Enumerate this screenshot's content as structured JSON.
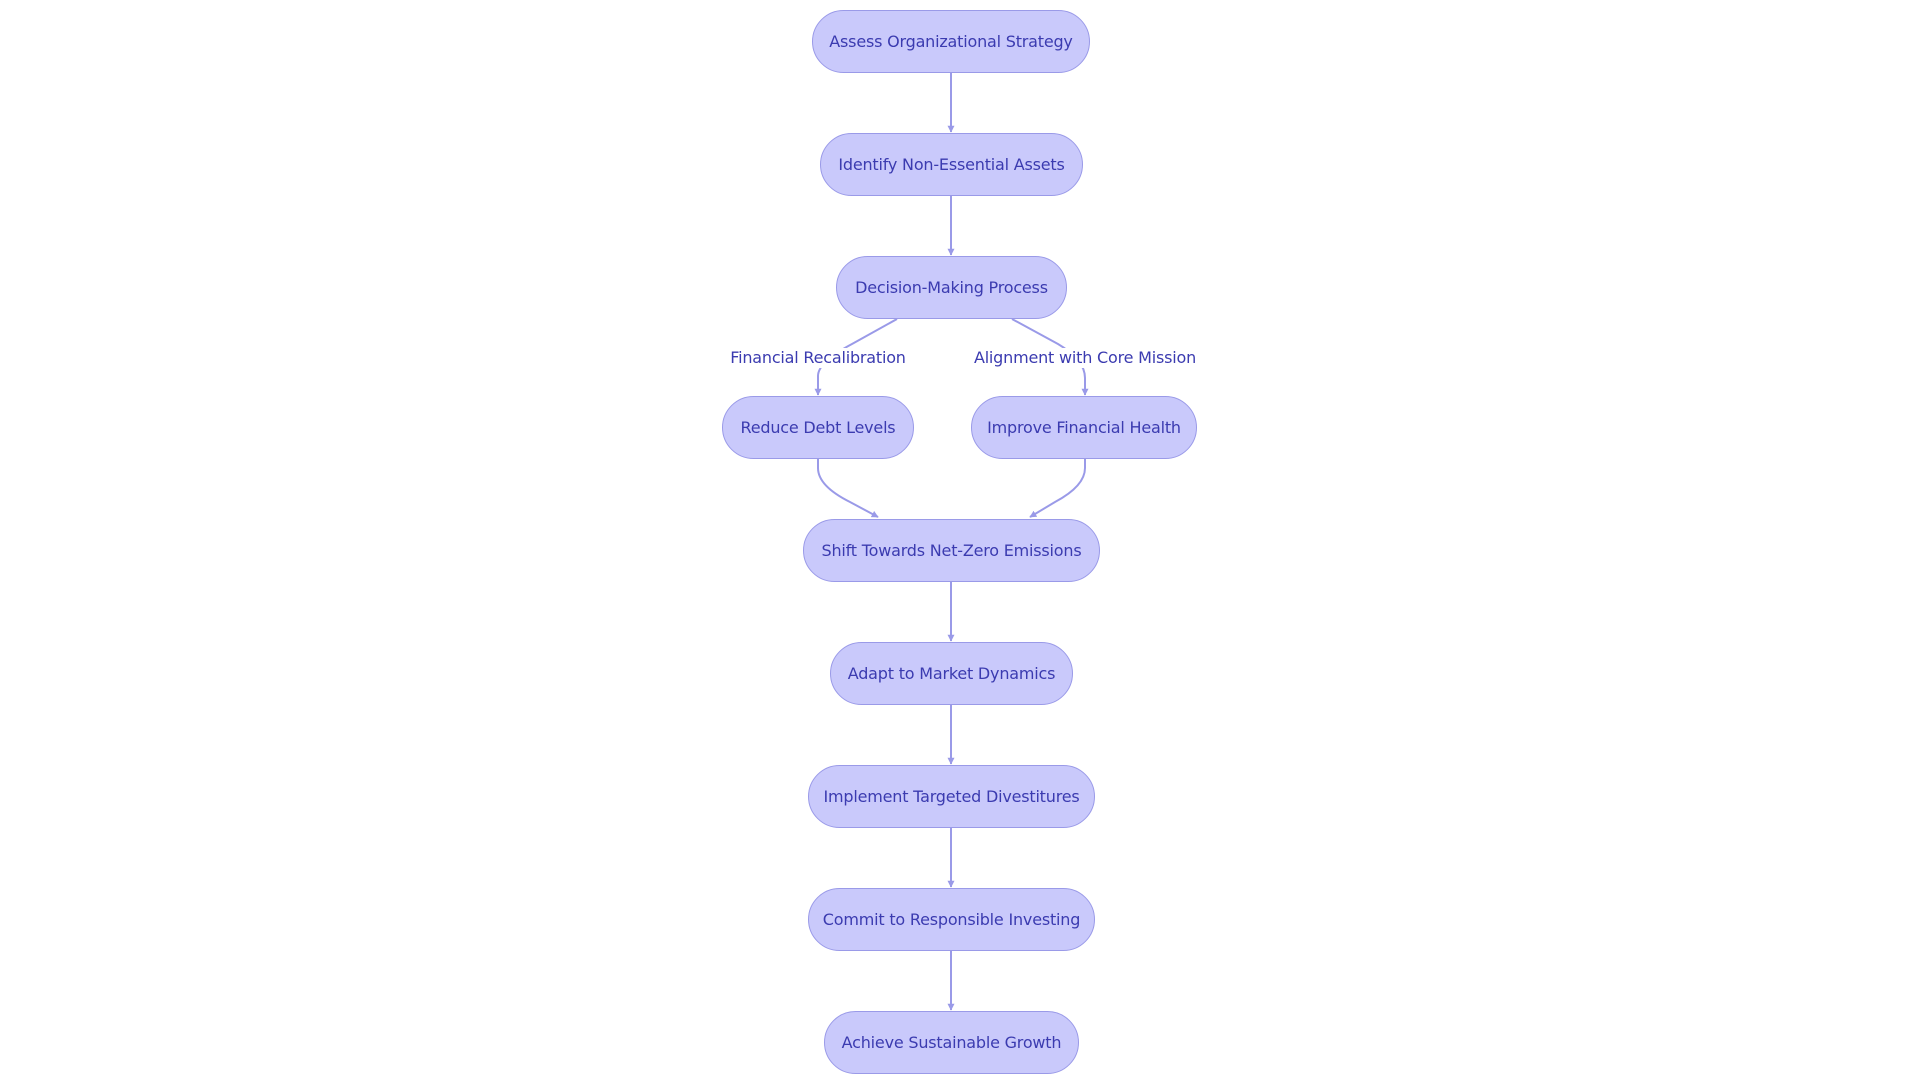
{
  "diagram": {
    "type": "flowchart",
    "direction": "top-to-bottom",
    "colors": {
      "node_fill": "#c9c9fb",
      "node_stroke": "#9a9ae8",
      "edge": "#9a9ae8",
      "text": "#3b3bb0",
      "background": "#ffffff"
    },
    "nodes": [
      {
        "id": "assess",
        "label": "Assess Organizational Strategy"
      },
      {
        "id": "identify",
        "label": "Identify Non-Essential Assets"
      },
      {
        "id": "decision",
        "label": "Decision-Making Process"
      },
      {
        "id": "reduce",
        "label": "Reduce Debt Levels"
      },
      {
        "id": "improve",
        "label": "Improve Financial Health"
      },
      {
        "id": "shift",
        "label": "Shift Towards Net-Zero Emissions"
      },
      {
        "id": "adapt",
        "label": "Adapt to Market Dynamics"
      },
      {
        "id": "implement",
        "label": "Implement Targeted Divestitures"
      },
      {
        "id": "commit",
        "label": "Commit to Responsible Investing"
      },
      {
        "id": "achieve",
        "label": "Achieve Sustainable Growth"
      }
    ],
    "edges": [
      {
        "from": "assess",
        "to": "identify",
        "label": ""
      },
      {
        "from": "identify",
        "to": "decision",
        "label": ""
      },
      {
        "from": "decision",
        "to": "reduce",
        "label": "Financial Recalibration"
      },
      {
        "from": "decision",
        "to": "improve",
        "label": "Alignment with Core Mission"
      },
      {
        "from": "reduce",
        "to": "shift",
        "label": ""
      },
      {
        "from": "improve",
        "to": "shift",
        "label": ""
      },
      {
        "from": "shift",
        "to": "adapt",
        "label": ""
      },
      {
        "from": "adapt",
        "to": "implement",
        "label": ""
      },
      {
        "from": "implement",
        "to": "commit",
        "label": ""
      },
      {
        "from": "commit",
        "to": "achieve",
        "label": ""
      }
    ]
  }
}
